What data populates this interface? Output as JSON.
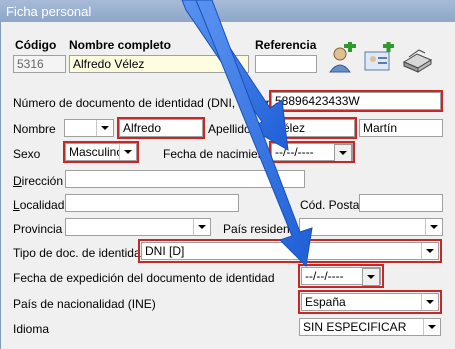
{
  "window": {
    "title": "Ficha personal"
  },
  "header": {
    "codigo_label": "Código",
    "codigo_value": "5316",
    "nombre_completo_label": "Nombre completo",
    "nombre_completo_value": "Alfredo Vélez",
    "referencia_label": "Referencia",
    "referencia_value": ""
  },
  "toolbar": {
    "icons": [
      "add-person-icon",
      "add-contact-card-icon",
      "scanner-icon"
    ]
  },
  "form": {
    "documento_label": "Número de documento de identidad (DNI, Pasaporte)",
    "documento_value": "58896423433W",
    "nombre_label": "Nombre",
    "nombre_prefix_value": "",
    "nombre_value": "Alfredo",
    "apellidos_label": "Apellidos",
    "apellido1_value": "Vélez",
    "apellido2_value": "Martín",
    "sexo_label": "Sexo",
    "sexo_value": "Masculino",
    "fecha_nacimiento_label": "Fecha de nacimiento",
    "fecha_nacimiento_value": "--/--/----",
    "direccion_label": "Dirección",
    "direccion_value": "",
    "localidad_label": "Localidad",
    "localidad_value": "",
    "cod_postal_label": "Cód. Postal",
    "cod_postal_value": "",
    "provincia_label": "Provincia",
    "provincia_value": "",
    "pais_residencia_label": "País residencia",
    "pais_residencia_value": "",
    "tipo_doc_label": "Tipo de doc. de identidad",
    "tipo_doc_value": "DNI [D]",
    "fecha_expedicion_label": "Fecha de expedición del documento de identidad",
    "fecha_expedicion_value": "--/--/----",
    "pais_nacionalidad_label": "País de nacionalidad (INE)",
    "pais_nacionalidad_value": "España",
    "idioma_label": "Idioma",
    "idioma_value": "SIN ESPECIFICAR"
  },
  "colors": {
    "highlight_red": "#c62828",
    "arrow_blue": "#2f6fe0",
    "titlebar": "#9bb1d1"
  }
}
